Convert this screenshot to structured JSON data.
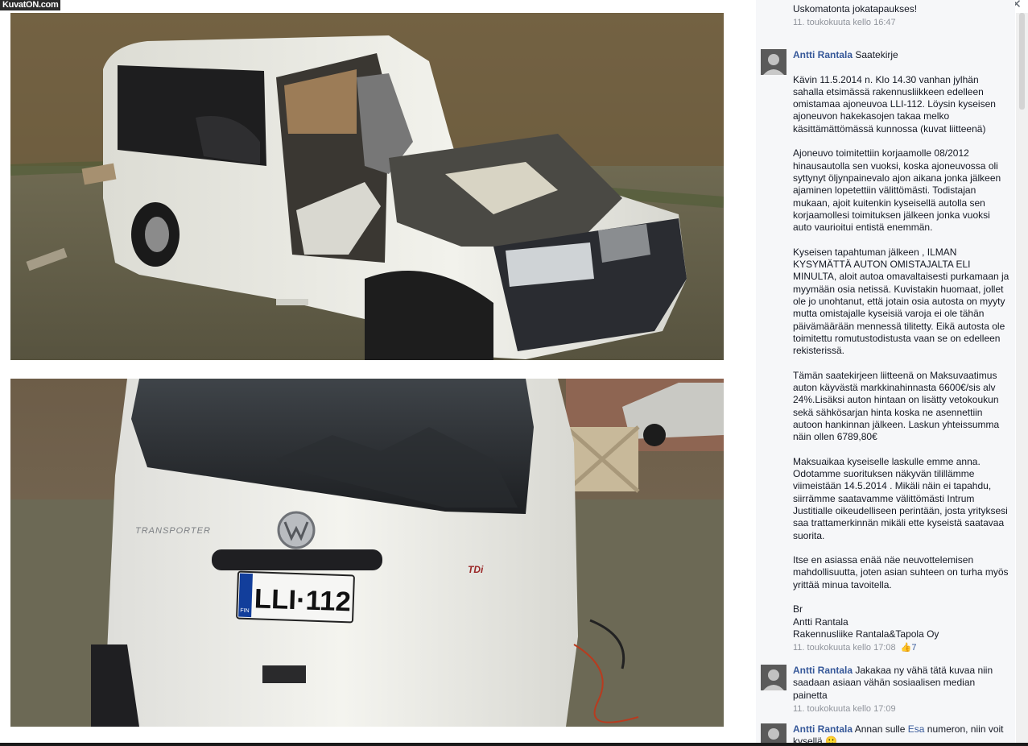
{
  "watermark": "KuvatON.com",
  "close_glyph": "✕",
  "photos": {
    "top": {
      "alt": "Purettu valkoinen pakettiauto"
    },
    "bottom": {
      "plate": "LLI·112",
      "plate_country": "FIN",
      "model_badge": "TRANSPORTER",
      "trim_badge": "TDi",
      "brand_logo": "VW"
    }
  },
  "comments": [
    {
      "text": "Uskomatonta jokatapaukses!",
      "time": "11. toukokuuta kello 16:47"
    },
    {
      "author": "Antti Rantala",
      "text": "Saatekirje\n\nKävin 11.5.2014 n. Klo 14.30 vanhan jylhän sahalla etsimässä rakennusliikkeen edelleen omistamaa ajoneuvoa LLI-112. Löysin kyseisen ajoneuvon hakekasojen takaa melko käsittämättömässä kunnossa (kuvat liitteenä)\n\nAjoneuvo toimitettiin korjaamolle 08/2012 hinausautolla sen vuoksi, koska ajoneuvossa oli syttynyt öljynpainevalo ajon aikana jonka jälkeen ajaminen lopetettiin välittömästi. Todistajan mukaan, ajoit kuitenkin kyseisellä autolla sen korjaamollesi toimituksen jälkeen jonka vuoksi auto vaurioitui entistä enemmän.\n\nKyseisen tapahtuman jälkeen , ILMAN KYSYMÄTTÄ AUTON OMISTAJALTA ELI MINULTA, aloit autoa omavaltaisesti purkamaan ja myymään osia netissä. Kuvistakin huomaat, jollet ole jo unohtanut, että jotain osia autosta on myyty mutta omistajalle kyseisiä varoja ei ole tähän päivämäärään mennessä tilitetty. Eikä autosta ole toimitettu romutustodistusta vaan se on edelleen rekisterissä.\n\nTämän saatekirjeen liitteenä on Maksuvaatimus auton käyvästä markkinahinnasta 6600€/sis alv 24%.Lisäksi auton hintaan on lisätty vetokoukun sekä sähkösarjan hinta koska ne asennettiin autoon hankinnan jälkeen. Laskun yhteissumma näin ollen 6789,80€\n\nMaksuaikaa kyseiselle laskulle emme anna. Odotamme suorituksen näkyvän tilillämme viimeistään 14.5.2014 . Mikäli näin ei tapahdu, siirrämme saatavamme välittömästi Intrum Justitialle oikeudelliseen perintään, josta yrityksesi saa trattamerkinnän mikäli ette kyseistä saatavaa suorita.\n\nItse en asiassa enää näe neuvottelemisen mahdollisuutta, joten asian suhteen on turha myös yrittää minua tavoitella.\n\nBr\nAntti Rantala\nRakennusliike Rantala&Tapola Oy",
      "time": "11. toukokuuta kello 17:08",
      "likes": "7"
    },
    {
      "author": "Antti Rantala",
      "text": "Jakakaa ny vähä tätä kuvaa niin saadaan asiaan vähän sosiaalisen median painetta",
      "time": "11. toukokuuta kello 17:09"
    },
    {
      "author": "Antti Rantala",
      "text_before": "Annan sulle",
      "mention": "Esa",
      "text_after": "numeron, niin voit kysellä"
    }
  ],
  "colors": {
    "link": "#365899",
    "meta": "#90949c",
    "sidebar_bg": "#f6f7f9",
    "van_white": "#ecebe4"
  }
}
